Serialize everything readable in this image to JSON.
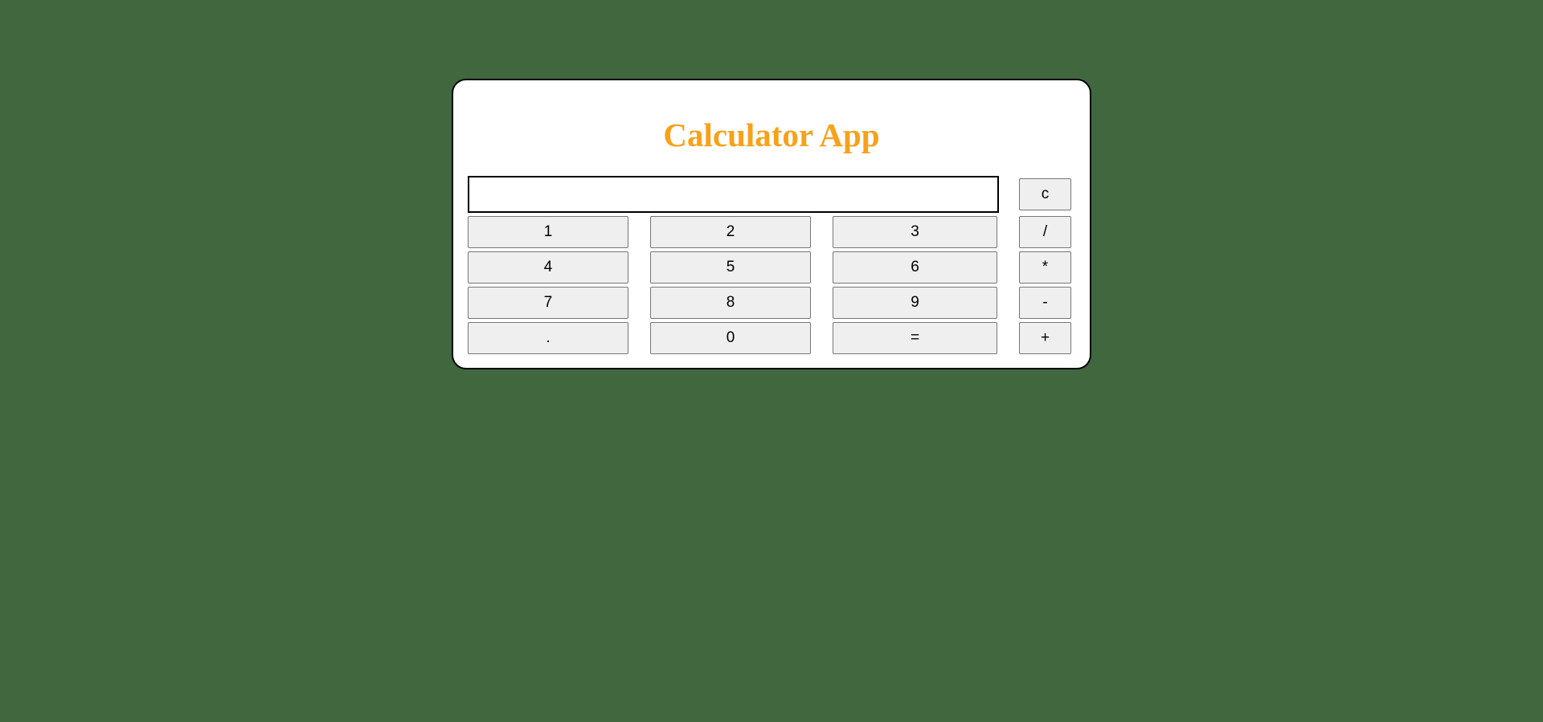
{
  "app": {
    "title": "Calculator App"
  },
  "display": {
    "value": "",
    "placeholder": ""
  },
  "buttons": {
    "clear": "c",
    "one": "1",
    "two": "2",
    "three": "3",
    "divide": "/",
    "four": "4",
    "five": "5",
    "six": "6",
    "multiply": "*",
    "seven": "7",
    "eight": "8",
    "nine": "9",
    "subtract": "-",
    "decimal": ".",
    "zero": "0",
    "equals": "=",
    "add": "+"
  },
  "colors": {
    "background": "#41673f",
    "card": "#ffffff",
    "title": "#f7a11a",
    "button": "#efefef"
  }
}
